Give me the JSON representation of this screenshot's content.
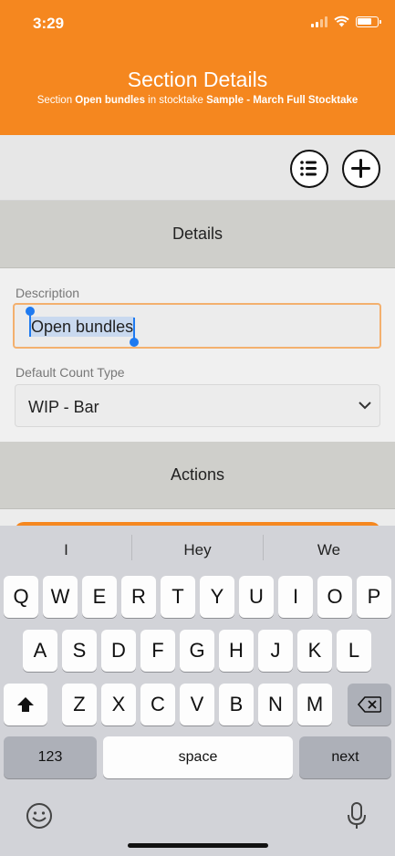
{
  "status": {
    "time": "3:29"
  },
  "header": {
    "title": "Section Details",
    "subtitle_pre": "Section ",
    "section_name": "Open bundles",
    "subtitle_mid": " in stocktake ",
    "stocktake_name": "Sample - March Full Stocktake"
  },
  "toolbar": {
    "list_icon": "list-icon",
    "add_icon": "add-circle-icon"
  },
  "sections": {
    "details": "Details",
    "actions": "Actions"
  },
  "form": {
    "description_label": "Description",
    "description_value": "Open bundles",
    "count_type_label": "Default Count Type",
    "count_type_value": "WIP - Bar"
  },
  "keyboard": {
    "suggestions": [
      "I",
      "Hey",
      "We"
    ],
    "row1": [
      "Q",
      "W",
      "E",
      "R",
      "T",
      "Y",
      "U",
      "I",
      "O",
      "P"
    ],
    "row2": [
      "A",
      "S",
      "D",
      "F",
      "G",
      "H",
      "J",
      "K",
      "L"
    ],
    "row3": [
      "Z",
      "X",
      "C",
      "V",
      "B",
      "N",
      "M"
    ],
    "numbers_label": "123",
    "space_label": "space",
    "next_label": "next"
  },
  "colors": {
    "accent": "#f5871f",
    "selection": "#1f7af0"
  }
}
